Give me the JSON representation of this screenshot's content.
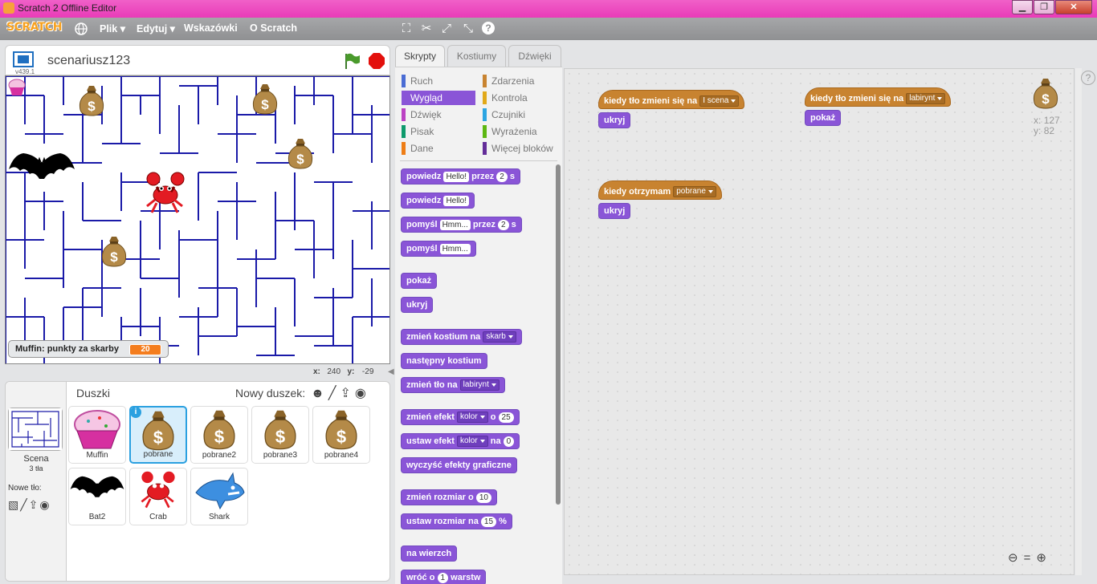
{
  "window": {
    "title": "Scratch 2 Offline Editor",
    "minimize": "▁",
    "maximize": "❐",
    "close": "✕"
  },
  "menubar": {
    "logo": "SCRATCH",
    "items": [
      "Plik",
      "Edytuj",
      "Wskazówki",
      "O Scratch"
    ],
    "tools": [
      "duplicate-icon",
      "delete-icon",
      "grow-icon",
      "shrink-icon",
      "help-icon"
    ]
  },
  "stage": {
    "project_name": "scenariusz123",
    "version": "v439.1",
    "monitor_label": "Muffin: punkty za skarby",
    "monitor_value": "20",
    "coords_x_label": "x:",
    "coords_x": "240",
    "coords_y_label": "y:",
    "coords_y": "-29",
    "maze_color": "#1a1aa8"
  },
  "sprites_panel": {
    "title": "Duszki",
    "new_sprite_label": "Nowy duszek:",
    "scene_label": "Scena",
    "scene_sub": "3 tła",
    "new_backdrop_label": "Nowe tło:",
    "sprites": [
      {
        "name": "Muffin",
        "icon": "muffin-icon"
      },
      {
        "name": "pobrane",
        "icon": "money-bag-icon",
        "selected": true
      },
      {
        "name": "pobrane2",
        "icon": "money-bag-icon"
      },
      {
        "name": "pobrane3",
        "icon": "money-bag-icon"
      },
      {
        "name": "pobrane4",
        "icon": "money-bag-icon"
      },
      {
        "name": "Bat2",
        "icon": "bat-icon"
      },
      {
        "name": "Crab",
        "icon": "crab-icon"
      },
      {
        "name": "Shark",
        "icon": "shark-icon"
      }
    ]
  },
  "tabs": [
    "Skrypty",
    "Kostiumy",
    "Dźwięki"
  ],
  "categories": {
    "left": [
      {
        "label": "Ruch",
        "color": "#4a6cd4"
      },
      {
        "label": "Wygląd",
        "color": "#8a55d7",
        "active": true
      },
      {
        "label": "Dźwięk",
        "color": "#bb42c3"
      },
      {
        "label": "Pisak",
        "color": "#0e9a6c"
      },
      {
        "label": "Dane",
        "color": "#ee7d16"
      }
    ],
    "right": [
      {
        "label": "Zdarzenia",
        "color": "#c88330"
      },
      {
        "label": "Kontrola",
        "color": "#e1a91a"
      },
      {
        "label": "Czujniki",
        "color": "#2ca5e2"
      },
      {
        "label": "Wyrażenia",
        "color": "#5cb712"
      },
      {
        "label": "Więcej bloków",
        "color": "#632d99"
      }
    ]
  },
  "palette": {
    "say_for": [
      "powiedz",
      "Hello!",
      "przez",
      "2",
      "s"
    ],
    "say": [
      "powiedz",
      "Hello!"
    ],
    "think_for": [
      "pomyśl",
      "Hmm...",
      "przez",
      "2",
      "s"
    ],
    "think": [
      "pomyśl",
      "Hmm..."
    ],
    "show": "pokaż",
    "hide": "ukryj",
    "switch_costume": [
      "zmień kostium na",
      "skarb"
    ],
    "next_costume": "następny kostium",
    "switch_backdrop": [
      "zmień tło na",
      "labirynt"
    ],
    "change_effect": [
      "zmień efekt",
      "kolor",
      "o",
      "25"
    ],
    "set_effect": [
      "ustaw efekt",
      "kolor",
      "na",
      "0"
    ],
    "clear_effects": "wyczyść efekty graficzne",
    "change_size": [
      "zmień rozmiar o",
      "10"
    ],
    "set_size": [
      "ustaw rozmiar na",
      "15",
      "%"
    ],
    "front": "na wierzch",
    "back": [
      "wróć o",
      "1",
      "warstw"
    ]
  },
  "scripts": {
    "s1_hat": [
      "kiedy tło zmieni się na",
      "I scena"
    ],
    "s1_body": "ukryj",
    "s2_hat": [
      "kiedy tło zmieni się na",
      "labirynt"
    ],
    "s2_body": "pokaż",
    "s3_hat": [
      "kiedy otrzymam",
      "pobrane"
    ],
    "s3_body": "ukryj",
    "sprite_x_label": "x:",
    "sprite_x": "127",
    "sprite_y_label": "y:",
    "sprite_y": "82",
    "help": "?"
  }
}
